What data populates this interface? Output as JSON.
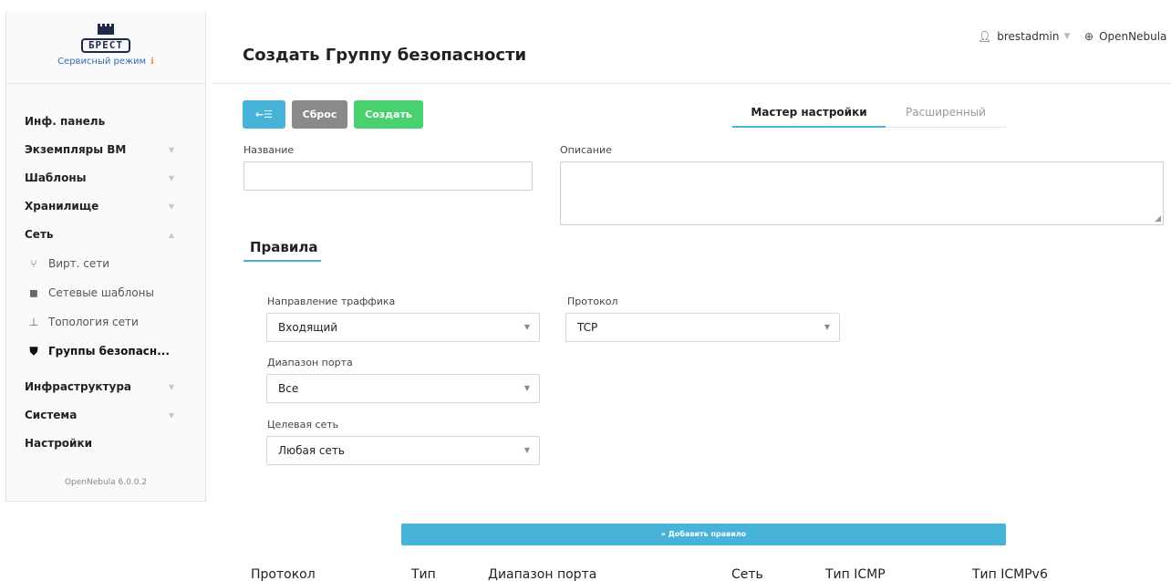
{
  "sidebar": {
    "logo_text": "БРЕСТ",
    "service_mode": "Сервисный режим",
    "items": [
      {
        "label": "Инф. панель"
      },
      {
        "label": "Экземпляры ВМ"
      },
      {
        "label": "Шаблоны"
      },
      {
        "label": "Хранилище"
      },
      {
        "label": "Сеть"
      },
      {
        "label": "Инфраструктура"
      },
      {
        "label": "Система"
      },
      {
        "label": "Настройки"
      }
    ],
    "network_subitems": [
      {
        "label": "Вирт. сети",
        "icon": "network-fork-icon"
      },
      {
        "label": "Сетевые шаблоны",
        "icon": "stacked-squares-icon"
      },
      {
        "label": "Топология сети",
        "icon": "sitemap-icon"
      },
      {
        "label": "Группы безопасн...",
        "icon": "shield-icon"
      }
    ],
    "version": "OpenNebula 6.0.0.2"
  },
  "header": {
    "title": "Создать Группу безопасности",
    "user": "brestadmin",
    "zone": "OpenNebula"
  },
  "toolbar": {
    "back_label": "←☰",
    "reset_label": "Сброс",
    "create_label": "Создать"
  },
  "tabs": {
    "wizard": "Мастер настройки",
    "advanced": "Расширенный"
  },
  "form": {
    "name_label": "Название",
    "name_value": "",
    "description_label": "Описание",
    "description_value": ""
  },
  "rules": {
    "section_title": "Правила",
    "direction_label": "Направление траффика",
    "direction_value": "Входящий",
    "protocol_label": "Протокол",
    "protocol_value": "TCP",
    "port_range_label": "Диапазон порта",
    "port_range_value": "Все",
    "target_label": "Целевая сеть",
    "target_value": "Любая сеть",
    "add_button": "» Добавить правило"
  },
  "table": {
    "headers": [
      "Протокол",
      "Тип",
      "Диапазон порта",
      "Сеть",
      "Тип ICMP",
      "Тип ICMPv6"
    ]
  },
  "colors": {
    "accent": "#47b3d9",
    "create": "#47d16f",
    "reset": "#8a8a8a",
    "info": "#e69a27"
  }
}
